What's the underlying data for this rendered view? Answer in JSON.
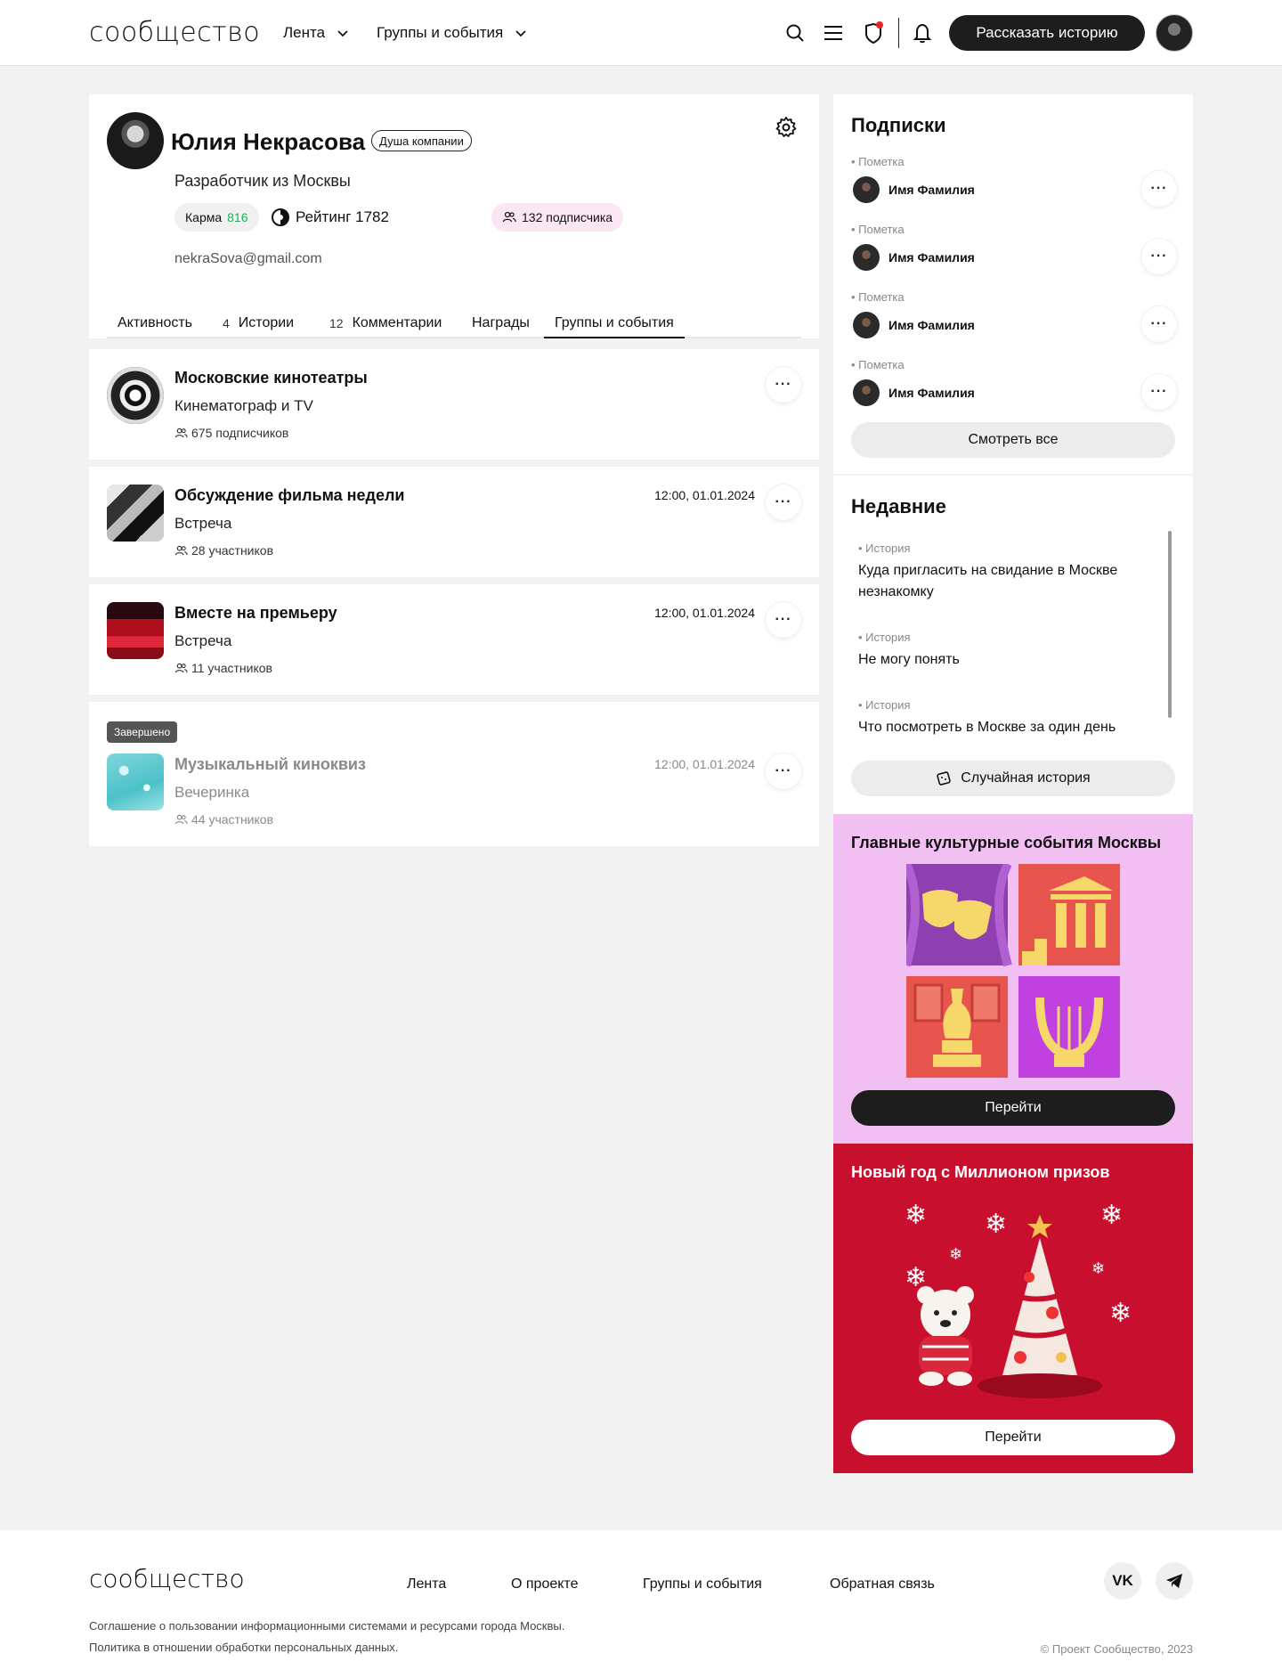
{
  "header": {
    "logo": "сообщество",
    "nav": [
      {
        "label": "Лента"
      },
      {
        "label": "Группы и события"
      }
    ],
    "story_button": "Рассказать историю"
  },
  "profile": {
    "name": "Юлия Некрасова",
    "badge": "Душа компании",
    "description": "Разработчик из Москвы",
    "karma_label": "Карма",
    "karma_value": "816",
    "rating": "Рейтинг 1782",
    "subscribers": "132 подписчика",
    "email": "nekraSova@gmail.com",
    "tabs": [
      {
        "label": "Активность",
        "count": ""
      },
      {
        "label": "Истории",
        "count": "4"
      },
      {
        "label": "Комментарии",
        "count": "12"
      },
      {
        "label": "Награды",
        "count": ""
      },
      {
        "label": "Группы и события",
        "count": ""
      }
    ]
  },
  "groups": [
    {
      "title": "Московские кинотеатры",
      "subtitle": "Кинематограф и TV",
      "count": "675 подписчиков",
      "date": ""
    },
    {
      "title": "Обсуждение фильма недели",
      "subtitle": "Встреча",
      "count": "28 участников",
      "date": "12:00, 01.01.2024"
    },
    {
      "title": "Вместе на премьеру",
      "subtitle": "Встреча",
      "count": "11 участников",
      "date": "12:00, 01.01.2024"
    },
    {
      "title": "Музыкальный киноквиз",
      "subtitle": "Вечеринка",
      "count": "44 участников",
      "date": "12:00, 01.01.2024",
      "status": "Завершено"
    }
  ],
  "subscriptions": {
    "title": "Подписки",
    "items": [
      {
        "mark": "• Пометка",
        "name": "Имя Фамилия"
      },
      {
        "mark": "• Пометка",
        "name": "Имя Фамилия"
      },
      {
        "mark": "• Пометка",
        "name": "Имя Фамилия"
      },
      {
        "mark": "• Пометка",
        "name": "Имя Фамилия"
      }
    ],
    "see_all": "Смотреть все"
  },
  "recent": {
    "title": "Недавние",
    "items": [
      {
        "mark": "• История",
        "text": "Куда пригласить на свидание в Москве незнакомку"
      },
      {
        "mark": "• История",
        "text": "Не могу понять"
      },
      {
        "mark": "• История",
        "text": "Что посмотреть в Москве за один день"
      }
    ],
    "random_button": "Случайная история"
  },
  "promos": [
    {
      "title": "Главные культурные события Москвы",
      "button": "Перейти"
    },
    {
      "title": "Новый год с Миллионом призов",
      "button": "Перейти"
    }
  ],
  "footer": {
    "logo": "сообщество",
    "links": [
      {
        "label": "Лента"
      },
      {
        "label": "О проекте"
      },
      {
        "label": "Группы и события"
      },
      {
        "label": "Обратная связь"
      }
    ],
    "vk": "VK",
    "legal1": "Соглашение о пользовании информационными системами и ресурсами города Москвы.",
    "legal2": "Политика в отношении обработки персональных данных.",
    "copyright": "©  Проект Сообщество, 2023"
  }
}
